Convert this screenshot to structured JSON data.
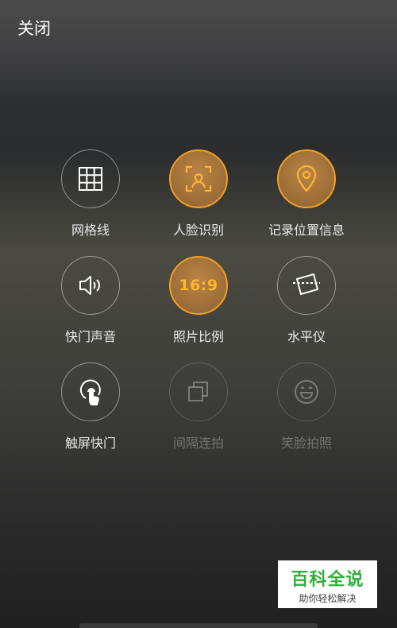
{
  "header": {
    "close_label": "关闭"
  },
  "colors": {
    "accent": "#f0a022",
    "ratio_text": "#ffb52e",
    "baike_green": "#2fb13a"
  },
  "options": [
    {
      "label": "网格线",
      "icon": "grid-icon",
      "state": "normal"
    },
    {
      "label": "人脸识别",
      "icon": "face-detect-icon",
      "state": "active"
    },
    {
      "label": "记录位置信息",
      "icon": "location-pin-icon",
      "state": "active"
    },
    {
      "label": "快门声音",
      "icon": "speaker-icon",
      "state": "normal"
    },
    {
      "label": "照片比例",
      "icon": "aspect-ratio-icon",
      "icon_text": "16:9",
      "state": "active"
    },
    {
      "label": "水平仪",
      "icon": "level-icon",
      "state": "normal"
    },
    {
      "label": "触屏快门",
      "icon": "touch-icon",
      "state": "normal"
    },
    {
      "label": "间隔连拍",
      "icon": "interval-shot-icon",
      "state": "disabled"
    },
    {
      "label": "笑脸拍照",
      "icon": "smile-icon",
      "state": "disabled"
    }
  ],
  "watermark": {
    "title": "百科全说",
    "subtitle": "助你轻松解决"
  }
}
